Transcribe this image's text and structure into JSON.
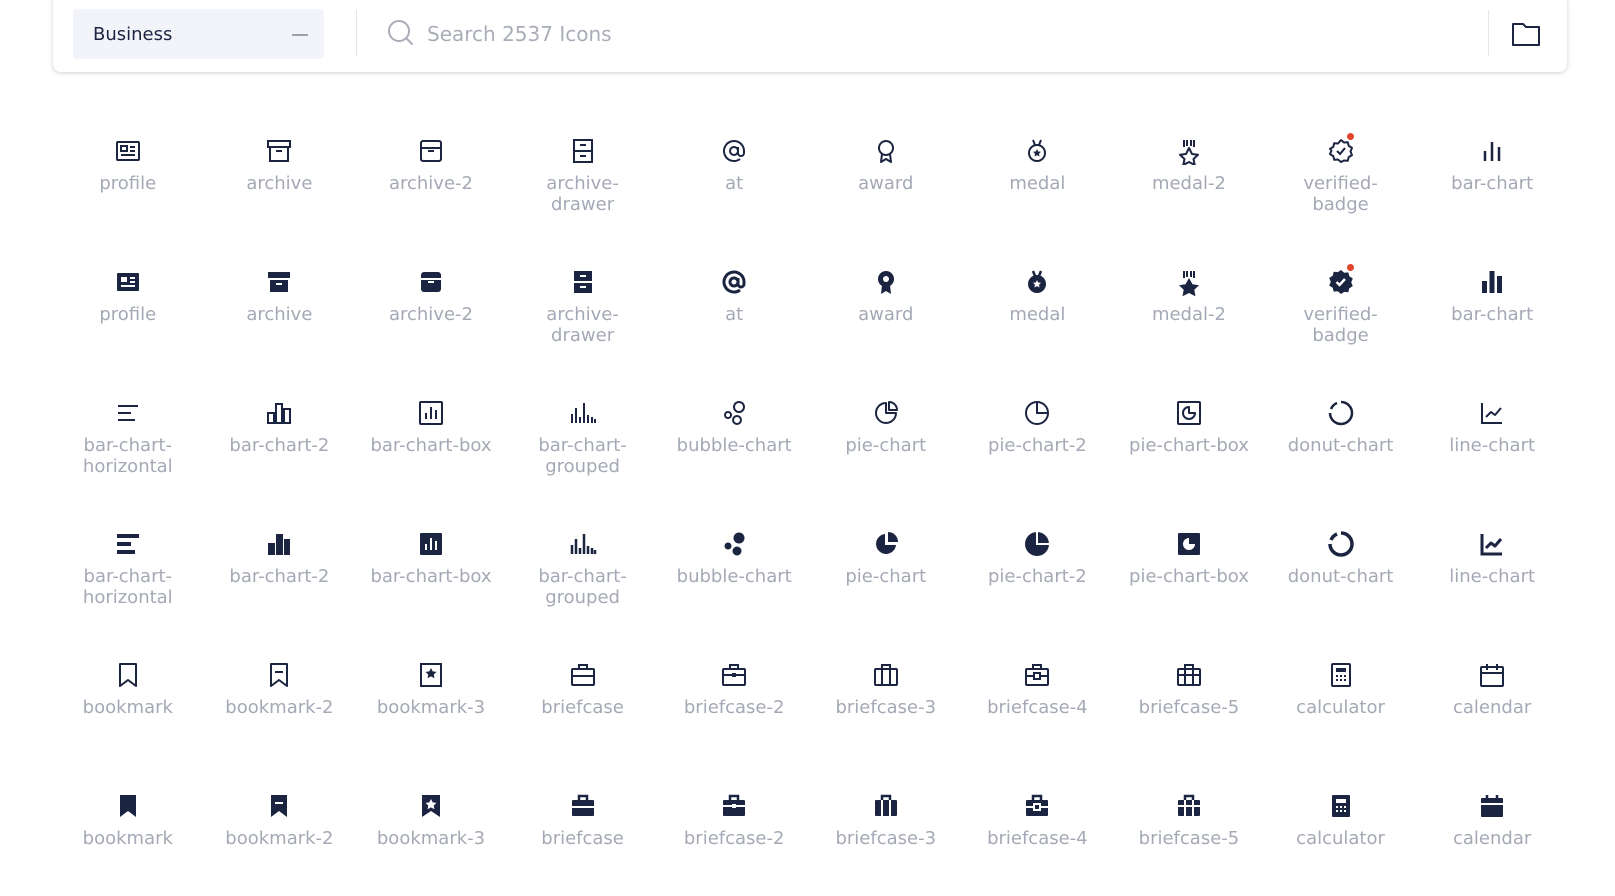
{
  "header": {
    "category": {
      "label": "Business",
      "icon": "minus-icon"
    },
    "search": {
      "icon": "search-icon",
      "placeholder": "Search 2537 Icons",
      "value": ""
    },
    "folder_icon": "folder-icon"
  },
  "colors": {
    "icon": "#1b2440",
    "label": "#a4a9b5",
    "new_dot": "#e0442b",
    "select_bg": "#f2f4fa"
  },
  "icons": [
    {
      "label": "profile",
      "glyph": "profile",
      "style": "outline",
      "new": false
    },
    {
      "label": "archive",
      "glyph": "archive",
      "style": "outline",
      "new": false
    },
    {
      "label": "archive-2",
      "glyph": "archive-2",
      "style": "outline",
      "new": false
    },
    {
      "label": "archive-drawer",
      "glyph": "archive-drawer",
      "style": "outline",
      "new": false
    },
    {
      "label": "at",
      "glyph": "at",
      "style": "outline",
      "new": false
    },
    {
      "label": "award",
      "glyph": "award",
      "style": "outline",
      "new": false
    },
    {
      "label": "medal",
      "glyph": "medal",
      "style": "outline",
      "new": false
    },
    {
      "label": "medal-2",
      "glyph": "medal-2",
      "style": "outline",
      "new": false
    },
    {
      "label": "verified-badge",
      "glyph": "verified-badge",
      "style": "outline",
      "new": true
    },
    {
      "label": "bar-chart",
      "glyph": "bar-chart",
      "style": "outline",
      "new": false
    },
    {
      "label": "profile",
      "glyph": "profile",
      "style": "filled",
      "new": false
    },
    {
      "label": "archive",
      "glyph": "archive",
      "style": "filled",
      "new": false
    },
    {
      "label": "archive-2",
      "glyph": "archive-2",
      "style": "filled",
      "new": false
    },
    {
      "label": "archive-drawer",
      "glyph": "archive-drawer",
      "style": "filled",
      "new": false
    },
    {
      "label": "at",
      "glyph": "at",
      "style": "filled",
      "new": false
    },
    {
      "label": "award",
      "glyph": "award",
      "style": "filled",
      "new": false
    },
    {
      "label": "medal",
      "glyph": "medal",
      "style": "filled",
      "new": false
    },
    {
      "label": "medal-2",
      "glyph": "medal-2",
      "style": "filled",
      "new": false
    },
    {
      "label": "verified-badge",
      "glyph": "verified-badge",
      "style": "filled",
      "new": true
    },
    {
      "label": "bar-chart",
      "glyph": "bar-chart",
      "style": "filled",
      "new": false
    },
    {
      "label": "bar-chart-horizontal",
      "glyph": "bar-chart-horizontal",
      "style": "outline",
      "new": false
    },
    {
      "label": "bar-chart-2",
      "glyph": "bar-chart-2",
      "style": "outline",
      "new": false
    },
    {
      "label": "bar-chart-box",
      "glyph": "bar-chart-box",
      "style": "outline",
      "new": false
    },
    {
      "label": "bar-chart-grouped",
      "glyph": "bar-chart-grouped",
      "style": "outline",
      "new": false
    },
    {
      "label": "bubble-chart",
      "glyph": "bubble-chart",
      "style": "outline",
      "new": false
    },
    {
      "label": "pie-chart",
      "glyph": "pie-chart",
      "style": "outline",
      "new": false
    },
    {
      "label": "pie-chart-2",
      "glyph": "pie-chart-2",
      "style": "outline",
      "new": false
    },
    {
      "label": "pie-chart-box",
      "glyph": "pie-chart-box",
      "style": "outline",
      "new": false
    },
    {
      "label": "donut-chart",
      "glyph": "donut-chart",
      "style": "outline",
      "new": false
    },
    {
      "label": "line-chart",
      "glyph": "line-chart",
      "style": "outline",
      "new": false
    },
    {
      "label": "bar-chart-horizontal",
      "glyph": "bar-chart-horizontal",
      "style": "filled",
      "new": false
    },
    {
      "label": "bar-chart-2",
      "glyph": "bar-chart-2",
      "style": "filled",
      "new": false
    },
    {
      "label": "bar-chart-box",
      "glyph": "bar-chart-box",
      "style": "filled",
      "new": false
    },
    {
      "label": "bar-chart-grouped",
      "glyph": "bar-chart-grouped",
      "style": "filled",
      "new": false
    },
    {
      "label": "bubble-chart",
      "glyph": "bubble-chart",
      "style": "filled",
      "new": false
    },
    {
      "label": "pie-chart",
      "glyph": "pie-chart",
      "style": "filled",
      "new": false
    },
    {
      "label": "pie-chart-2",
      "glyph": "pie-chart-2",
      "style": "filled",
      "new": false
    },
    {
      "label": "pie-chart-box",
      "glyph": "pie-chart-box",
      "style": "filled",
      "new": false
    },
    {
      "label": "donut-chart",
      "glyph": "donut-chart",
      "style": "filled",
      "new": false
    },
    {
      "label": "line-chart",
      "glyph": "line-chart",
      "style": "filled",
      "new": false
    },
    {
      "label": "bookmark",
      "glyph": "bookmark",
      "style": "outline",
      "new": false
    },
    {
      "label": "bookmark-2",
      "glyph": "bookmark-2",
      "style": "outline",
      "new": false
    },
    {
      "label": "bookmark-3",
      "glyph": "bookmark-3",
      "style": "outline",
      "new": false
    },
    {
      "label": "briefcase",
      "glyph": "briefcase",
      "style": "outline",
      "new": false
    },
    {
      "label": "briefcase-2",
      "glyph": "briefcase-2",
      "style": "outline",
      "new": false
    },
    {
      "label": "briefcase-3",
      "glyph": "briefcase-3",
      "style": "outline",
      "new": false
    },
    {
      "label": "briefcase-4",
      "glyph": "briefcase-4",
      "style": "outline",
      "new": false
    },
    {
      "label": "briefcase-5",
      "glyph": "briefcase-5",
      "style": "outline",
      "new": false
    },
    {
      "label": "calculator",
      "glyph": "calculator",
      "style": "outline",
      "new": false
    },
    {
      "label": "calendar",
      "glyph": "calendar",
      "style": "outline",
      "new": false
    },
    {
      "label": "bookmark",
      "glyph": "bookmark",
      "style": "filled",
      "new": false
    },
    {
      "label": "bookmark-2",
      "glyph": "bookmark-2",
      "style": "filled",
      "new": false
    },
    {
      "label": "bookmark-3",
      "glyph": "bookmark-3",
      "style": "filled",
      "new": false
    },
    {
      "label": "briefcase",
      "glyph": "briefcase",
      "style": "filled",
      "new": false
    },
    {
      "label": "briefcase-2",
      "glyph": "briefcase-2",
      "style": "filled",
      "new": false
    },
    {
      "label": "briefcase-3",
      "glyph": "briefcase-3",
      "style": "filled",
      "new": false
    },
    {
      "label": "briefcase-4",
      "glyph": "briefcase-4",
      "style": "filled",
      "new": false
    },
    {
      "label": "briefcase-5",
      "glyph": "briefcase-5",
      "style": "filled",
      "new": false
    },
    {
      "label": "calculator",
      "glyph": "calculator",
      "style": "filled",
      "new": false
    },
    {
      "label": "calendar",
      "glyph": "calendar",
      "style": "filled",
      "new": false
    }
  ]
}
